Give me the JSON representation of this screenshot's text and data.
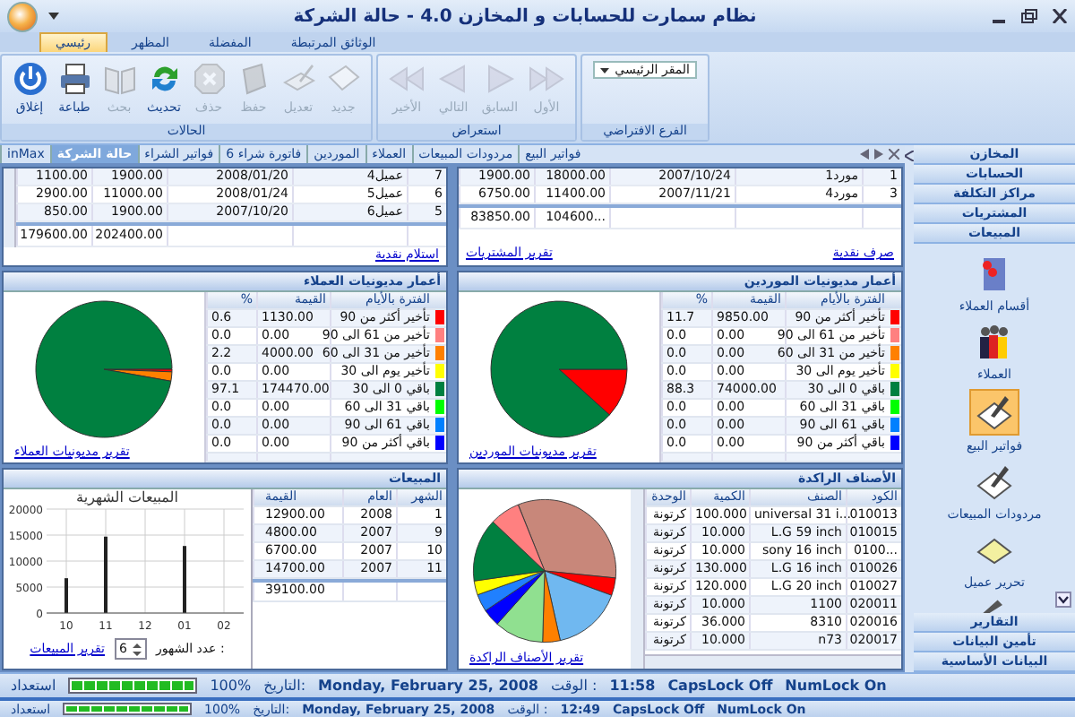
{
  "window": {
    "title": "نظام سمارت للحسابات و المخازن 4.0 - حالة الشركة"
  },
  "ribbon": {
    "tabs": [
      {
        "label": "الوثائق المرتبطة",
        "selected": false
      },
      {
        "label": "المفضلة",
        "selected": false
      },
      {
        "label": "المظهر",
        "selected": false
      },
      {
        "label": "رئيسي",
        "selected": true
      }
    ],
    "groups": [
      {
        "kind": "dropdown",
        "title": "الفرع الافتراضي",
        "value": "المقر الرئيسي"
      },
      {
        "kind": "buttons",
        "title": "استعراض",
        "buttons": [
          {
            "label": "الأول",
            "disabled": true
          },
          {
            "label": "السابق",
            "disabled": true
          },
          {
            "label": "التالي",
            "disabled": true
          },
          {
            "label": "الأخير",
            "disabled": true
          }
        ]
      },
      {
        "kind": "buttons",
        "title": "الحالات",
        "buttons": [
          {
            "label": "جديد",
            "disabled": true
          },
          {
            "label": "تعديل",
            "disabled": true
          },
          {
            "label": "حفظ",
            "disabled": true
          },
          {
            "label": "حذف",
            "disabled": true
          },
          {
            "label": "تحديث",
            "disabled": false
          },
          {
            "label": "بحث",
            "disabled": true
          },
          {
            "label": "طباعة",
            "disabled": false
          },
          {
            "label": "إغلاق",
            "disabled": false
          }
        ]
      }
    ]
  },
  "doc_tabs": [
    {
      "label": "فواتير البيع",
      "selected": false
    },
    {
      "label": "مردودات المبيعات",
      "selected": false
    },
    {
      "label": "العملاء",
      "selected": false
    },
    {
      "label": "الموردين",
      "selected": false
    },
    {
      "label": "فاتورة شراء 6",
      "selected": false
    },
    {
      "label": "فواتير الشراء",
      "selected": false
    },
    {
      "label": "حالة الشركة",
      "selected": true
    },
    {
      "label": "inMax",
      "selected": false
    }
  ],
  "customers_panel": {
    "rows": [
      [
        "7",
        "عميل4",
        "2008/01/20",
        "1900.00",
        "1100.00"
      ],
      [
        "6",
        "عميل5",
        "2008/01/24",
        "11000.00",
        "2900.00"
      ],
      [
        "5",
        "عميل6",
        "2007/10/20",
        "1900.00",
        "850.00"
      ]
    ],
    "totals": [
      "202400.00",
      "179600.00"
    ],
    "links": [
      "استلام نقدية"
    ]
  },
  "suppliers_panel": {
    "rows": [
      [
        "1",
        "مورد1",
        "2007/10/24",
        "18000.00",
        "1900.00"
      ],
      [
        "3",
        "مورد4",
        "2007/11/21",
        "11400.00",
        "6750.00"
      ]
    ],
    "totals": [
      "...104600",
      "83850.00"
    ],
    "links": [
      "صرف نقدية",
      "تقرير المشتريات"
    ]
  },
  "aging": [
    {
      "title": "أعمار مديونيات الموردين",
      "columns": [
        "الفترة بالأيام",
        "القيمة",
        "%"
      ],
      "link": "تقرير مديونيات الموردين",
      "rows": [
        {
          "color": "#ff0000",
          "period": "تأخير أكثر من 90",
          "value": "9850.00",
          "percent": "11.7"
        },
        {
          "color": "#ff8080",
          "period": "تأخير من 61 الى 90",
          "value": "0.00",
          "percent": "0.0"
        },
        {
          "color": "#ff8000",
          "period": "تأخير من 31 الى 60",
          "value": "0.00",
          "percent": "0.0"
        },
        {
          "color": "#ffff00",
          "period": "تأخير يوم الى 30",
          "value": "0.00",
          "percent": "0.0"
        },
        {
          "color": "#008040",
          "period": "باقي 0 الى 30",
          "value": "74000.00",
          "percent": "88.3"
        },
        {
          "color": "#00ff00",
          "period": "باقي 31 الى 60",
          "value": "0.00",
          "percent": "0.0"
        },
        {
          "color": "#0080ff",
          "period": "باقي 61 الى 90",
          "value": "0.00",
          "percent": "0.0"
        },
        {
          "color": "#0000ff",
          "period": "باقي أكثر من 90",
          "value": "0.00",
          "percent": "0.0"
        }
      ]
    },
    {
      "title": "أعمار مديونيات العملاء",
      "columns": [
        "الفترة بالأيام",
        "القيمة",
        "%"
      ],
      "link": "تقرير مديونيات العملاء",
      "rows": [
        {
          "color": "#ff0000",
          "period": "تأخير أكثر من 90",
          "value": "1130.00",
          "percent": "0.6"
        },
        {
          "color": "#ff8080",
          "period": "تأخير من 61 الى 90",
          "value": "0.00",
          "percent": "0.0"
        },
        {
          "color": "#ff8000",
          "period": "تأخير من 31 الى 60",
          "value": "4000.00",
          "percent": "2.2"
        },
        {
          "color": "#ffff00",
          "period": "تأخير يوم الى 30",
          "value": "0.00",
          "percent": "0.0"
        },
        {
          "color": "#008040",
          "period": "باقي 0 الى 30",
          "value": "174470.00",
          "percent": "97.1"
        },
        {
          "color": "#00ff00",
          "period": "باقي 31 الى 60",
          "value": "0.00",
          "percent": "0.0"
        },
        {
          "color": "#0080ff",
          "period": "باقي 61 الى 90",
          "value": "0.00",
          "percent": "0.0"
        },
        {
          "color": "#0000ff",
          "period": "باقي أكثر من 90",
          "value": "0.00",
          "percent": "0.0"
        }
      ]
    }
  ],
  "stagnant": {
    "title": "الأصناف الراكدة",
    "columns": [
      "الكود",
      "الصنف",
      "الكمية",
      "الوحدة"
    ],
    "link": "تقرير الأصناف الراكدة",
    "rows": [
      [
        "010013",
        "universal 31 i...",
        "100.000",
        "كرتونة"
      ],
      [
        "010015",
        "L.G 59 inch",
        "10.000",
        "كرتونة"
      ],
      [
        "...0100",
        "sony 16 inch",
        "10.000",
        "كرتونة"
      ],
      [
        "010026",
        "L.G 16 inch",
        "130.000",
        "كرتونة"
      ],
      [
        "010027",
        "L.G 20 inch",
        "120.000",
        "كرتونة"
      ],
      [
        "020011",
        "1100",
        "10.000",
        "كرتونة"
      ],
      [
        "020016",
        "8310",
        "36.000",
        "كرتونة"
      ],
      [
        "020017",
        "n73",
        "10.000",
        "كرتونة"
      ]
    ]
  },
  "sales": {
    "title": "المبيعات",
    "columns": [
      "الشهر",
      "العام",
      "القيمة"
    ],
    "rows": [
      [
        "1",
        "2008",
        "12900.00"
      ],
      [
        "9",
        "2007",
        "4800.00"
      ],
      [
        "10",
        "2007",
        "6700.00"
      ],
      [
        "11",
        "2007",
        "14700.00"
      ]
    ],
    "total": "39100.00",
    "chart_data": {
      "type": "bar",
      "title": "المبيعات الشهرية",
      "categories": [
        "10",
        "11",
        "12",
        "01",
        "02"
      ],
      "values": [
        6700,
        14700,
        0,
        12900,
        0
      ],
      "ylim": [
        0,
        20000
      ],
      "yticks": [
        0,
        5000,
        10000,
        15000,
        20000
      ],
      "grid": true
    },
    "months_label": "عدد الشهور :",
    "months": "6",
    "link": "تقرير المبيعات"
  },
  "sidebar": {
    "top_sections": [
      "المخازن",
      "الحسابات",
      "مراكز التكلفة",
      "المشتريات",
      "المبيعات"
    ],
    "items": [
      {
        "label": "أقسام العملاء",
        "selected": false
      },
      {
        "label": "العملاء",
        "selected": false
      },
      {
        "label": "فواتير البيع",
        "selected": true
      },
      {
        "label": "مردودات المبيعات",
        "selected": false
      },
      {
        "label": "تحرير عميل",
        "selected": false
      }
    ],
    "bottom_sections": [
      "التقارير",
      "تأمين البيانات",
      "البيانات الأساسية"
    ]
  },
  "status_bars": [
    {
      "ready": "استعداد",
      "level": 1,
      "percent": "100%",
      "date_label": "التاريخ:",
      "date": "Monday, February 25, 2008",
      "time_label": "الوقت :",
      "time": "11:58",
      "caps": "CapsLock Off",
      "num": "NumLock On"
    },
    {
      "ready": "استعداد",
      "level": 1,
      "percent": "100%",
      "date_label": "التاريخ:",
      "date": "Monday, February 25, 2008",
      "time_label": "الوقت :",
      "time": "12:49",
      "caps": "CapsLock Off",
      "num": "NumLock On"
    }
  ]
}
